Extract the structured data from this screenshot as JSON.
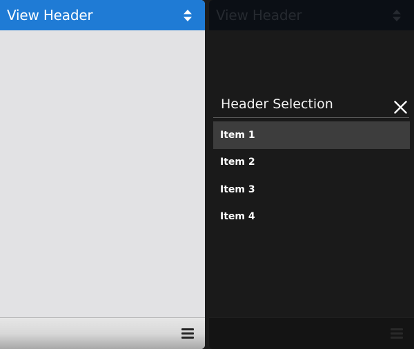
{
  "left_view": {
    "header": {
      "title": "View Header",
      "sort_icon": "sort-updown-icon"
    },
    "toolbar": {
      "menu_icon": "menu-icon"
    }
  },
  "right_view": {
    "header": {
      "title": "View Header"
    },
    "dialog": {
      "title": "Header Selection",
      "close_icon": "close-icon",
      "items": [
        {
          "label": "Item 1",
          "selected": true
        },
        {
          "label": "Item 2",
          "selected": false
        },
        {
          "label": "Item 3",
          "selected": false
        },
        {
          "label": "Item 4",
          "selected": false
        }
      ]
    },
    "toolbar": {
      "menu_icon": "menu-icon"
    }
  },
  "colors": {
    "header_accent": "#1f7bd5",
    "selected_item": "#3d3d3d",
    "dim_background": "#1a1a1a"
  }
}
